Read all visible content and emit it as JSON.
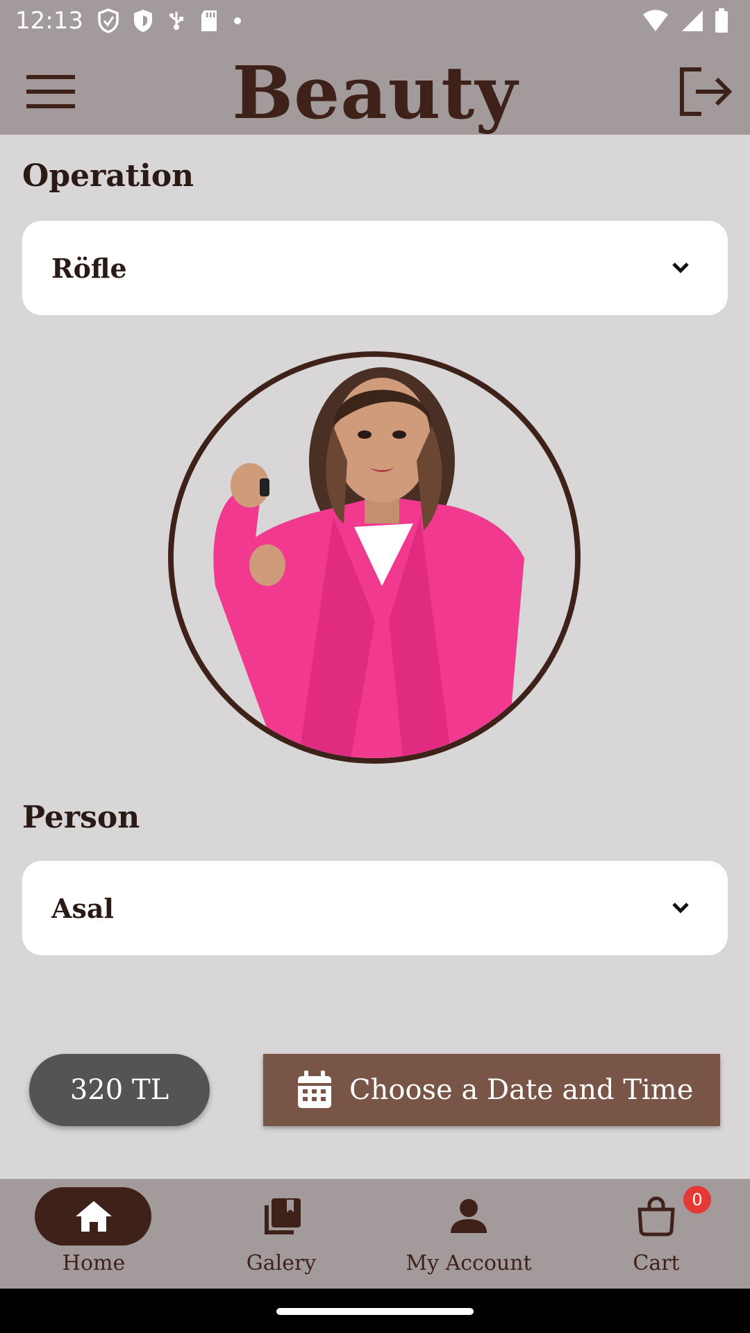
{
  "status_bar": {
    "time": "12:13",
    "left_icons": [
      "shield-outline-icon",
      "shield-filled-icon",
      "usb-icon",
      "sd-card-icon",
      "dot-icon"
    ],
    "right_icons": [
      "wifi-icon",
      "signal-icon",
      "battery-icon"
    ]
  },
  "app_bar": {
    "title": "Beauty",
    "menu_icon": "menu-icon",
    "logout_icon": "logout-icon"
  },
  "operation": {
    "label": "Operation",
    "selected": "Röfle"
  },
  "person": {
    "label": "Person",
    "selected": "Asal"
  },
  "price": "320 TL",
  "date_button": {
    "label": "Choose a Date and Time",
    "icon": "calendar-icon"
  },
  "bottom_nav": {
    "items": [
      {
        "label": "Home",
        "icon": "home-icon",
        "active": true
      },
      {
        "label": "Galery",
        "icon": "gallery-icon",
        "active": false
      },
      {
        "label": "My Account",
        "icon": "person-icon",
        "active": false
      },
      {
        "label": "Cart",
        "icon": "shopping-bag-icon",
        "active": false,
        "badge": "0"
      }
    ]
  },
  "colors": {
    "brown_dark": "#3e2219",
    "brown_button": "#795548",
    "bar_gray": "#a29a9b",
    "background": "#d8d6d7",
    "badge_red": "#e53935",
    "price_pill": "#545454"
  }
}
